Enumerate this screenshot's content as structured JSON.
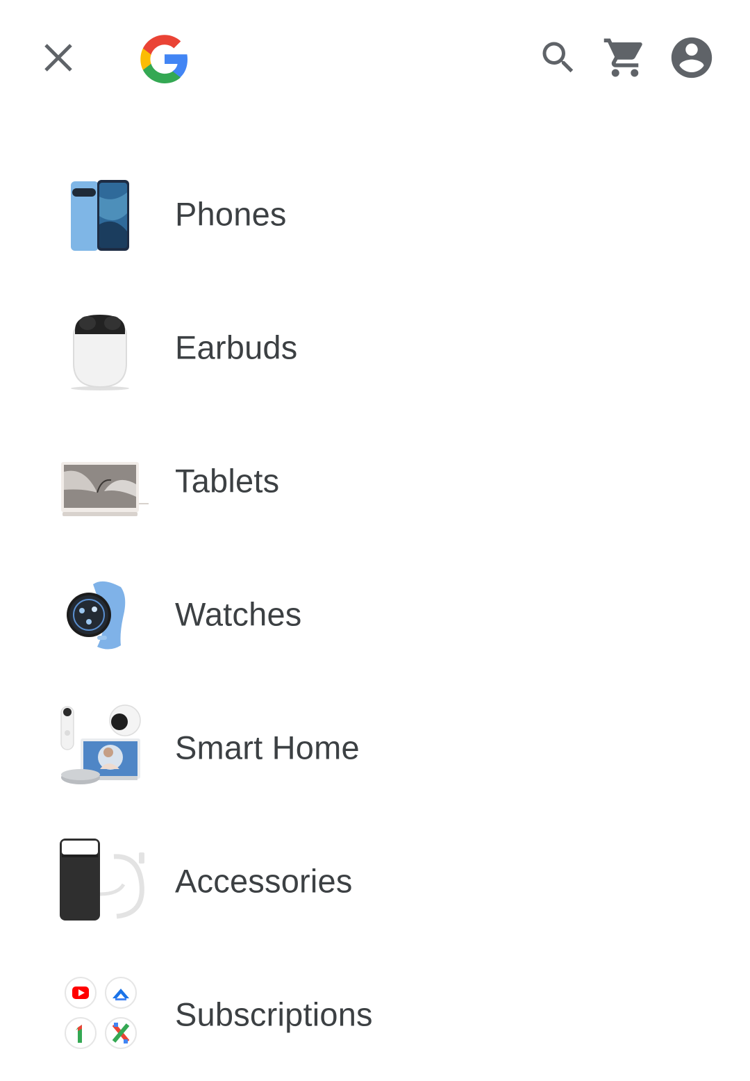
{
  "header": {
    "logo_letter": "G",
    "icons": {
      "close": "close-icon",
      "logo": "google-logo-icon",
      "search": "search-icon",
      "cart": "cart-icon",
      "account": "account-circle-icon"
    },
    "colors": {
      "icon": "#5f6368",
      "google_blue": "#4285F4",
      "google_red": "#EA4335",
      "google_yellow": "#FBBC05",
      "google_green": "#34A853"
    }
  },
  "menu": {
    "items": [
      {
        "label": "Phones",
        "icon": "phone-thumbnail"
      },
      {
        "label": "Earbuds",
        "icon": "earbuds-thumbnail"
      },
      {
        "label": "Tablets",
        "icon": "tablet-thumbnail"
      },
      {
        "label": "Watches",
        "icon": "watch-thumbnail"
      },
      {
        "label": "Smart Home",
        "icon": "smart-home-thumbnail"
      },
      {
        "label": "Accessories",
        "icon": "accessories-thumbnail"
      },
      {
        "label": "Subscriptions",
        "icon": "subscriptions-thumbnail"
      }
    ]
  }
}
